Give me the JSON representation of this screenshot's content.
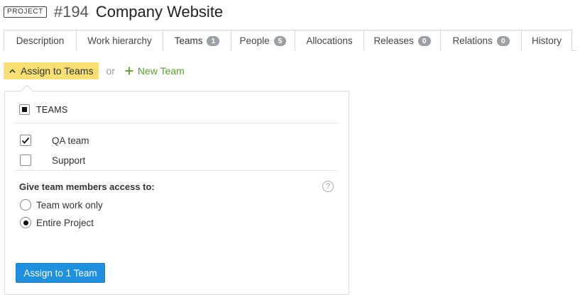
{
  "header": {
    "entity_type": "PROJECT",
    "entity_id": "#194",
    "entity_name": "Company Website"
  },
  "tabs": [
    {
      "label": "Description",
      "count": null,
      "active": false
    },
    {
      "label": "Work hierarchy",
      "count": null,
      "active": false
    },
    {
      "label": "Teams",
      "count": "1",
      "active": true
    },
    {
      "label": "People",
      "count": "5",
      "active": false
    },
    {
      "label": "Allocations",
      "count": null,
      "active": false
    },
    {
      "label": "Releases",
      "count": "0",
      "active": false
    },
    {
      "label": "Relations",
      "count": "0",
      "active": false
    },
    {
      "label": "History",
      "count": null,
      "active": false
    }
  ],
  "actions": {
    "assign_label": "Assign to Teams",
    "or_text": "or",
    "new_team_label": "New Team",
    "assign_icon": "chevron-up-icon",
    "new_team_icon": "plus-icon"
  },
  "popover": {
    "teams_header": "TEAMS",
    "teams_header_state": "indeterminate",
    "teams": [
      {
        "name": "QA team",
        "checked": true
      },
      {
        "name": "Support",
        "checked": false
      }
    ],
    "access_label": "Give team members access to:",
    "help_icon": "question-icon",
    "access_options": [
      {
        "label": "Team work only",
        "selected": false
      },
      {
        "label": "Entire Project",
        "selected": true
      }
    ],
    "submit_label": "Assign to 1 Team"
  },
  "colors": {
    "assign_bg": "#f7df72",
    "new_team_green": "#5aa02c",
    "submit_blue": "#1f8fe0",
    "badge_gray": "#9aa0a6"
  }
}
